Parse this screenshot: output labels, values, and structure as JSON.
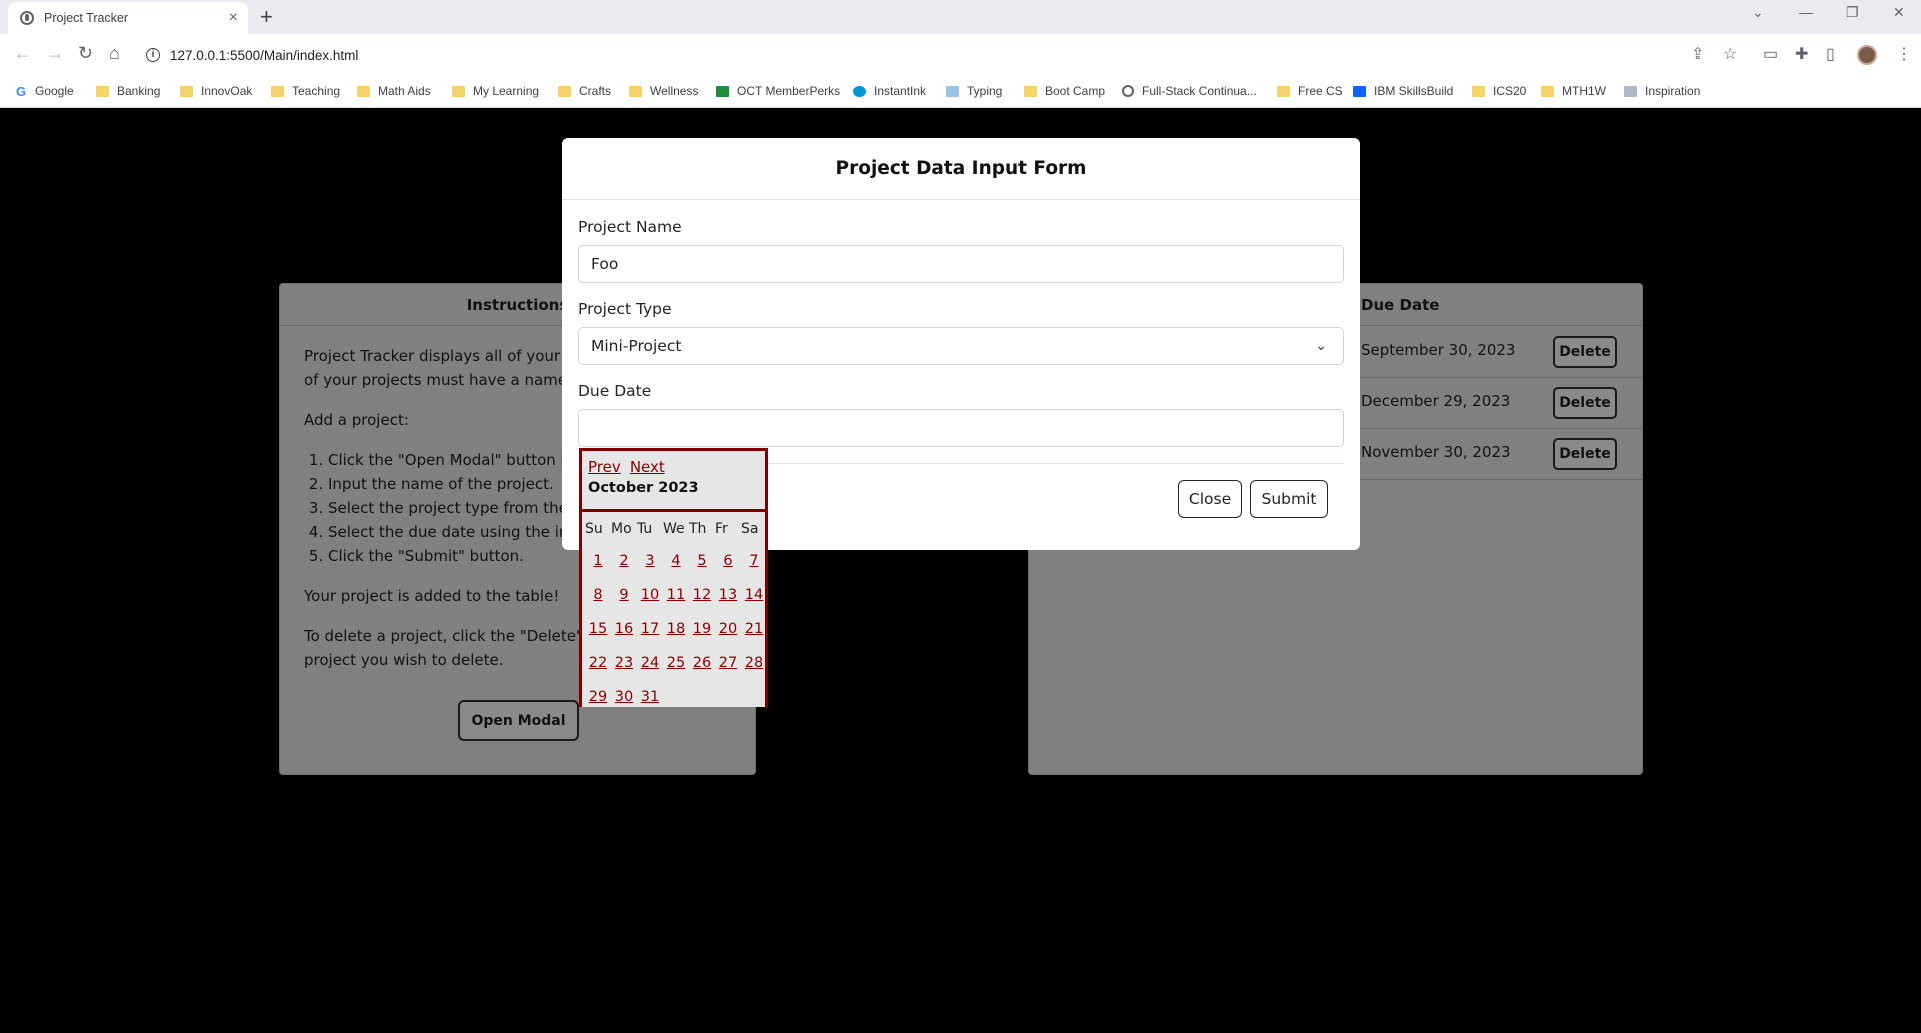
{
  "browser": {
    "tab_title": "Project Tracker",
    "tab_close": "×",
    "new_tab": "+",
    "url": "127.0.0.1:5500/Main/index.html",
    "bookmarks": [
      {
        "label": "Google",
        "icon": "google-icon"
      },
      {
        "label": "Banking",
        "icon": "folder-icon"
      },
      {
        "label": "InnovOak",
        "icon": "folder-icon"
      },
      {
        "label": "Teaching",
        "icon": "folder-icon"
      },
      {
        "label": "Math Aids",
        "icon": "folder-icon"
      },
      {
        "label": "My Learning",
        "icon": "folder-icon"
      },
      {
        "label": "Crafts",
        "icon": "folder-icon"
      },
      {
        "label": "Wellness",
        "icon": "folder-icon"
      },
      {
        "label": "OCT MemberPerks",
        "icon": "oct-icon"
      },
      {
        "label": "InstantInk",
        "icon": "hp-icon"
      },
      {
        "label": "Typing",
        "icon": "typing-icon"
      },
      {
        "label": "Boot Camp",
        "icon": "folder-icon"
      },
      {
        "label": "Full-Stack Continua...",
        "icon": "globe-icon"
      },
      {
        "label": "Free CS",
        "icon": "folder-icon"
      },
      {
        "label": "IBM SkillsBuild",
        "icon": "ibm-icon"
      },
      {
        "label": "ICS20",
        "icon": "folder-icon"
      },
      {
        "label": "MTH1W",
        "icon": "folder-icon"
      },
      {
        "label": "Inspiration",
        "icon": "nf-icon"
      }
    ]
  },
  "instructions": {
    "header": "Instructions",
    "intro_1": "Project Tracker displays all of your p",
    "intro_2": "of your projects must have a name,",
    "add_heading": "Add a project:",
    "steps": [
      "Click the \"Open Modal\" button b",
      "Input the name of the project.",
      "Select the project type from the",
      "Select the due date using the int",
      "Click the \"Submit\" button."
    ],
    "added": "Your project is added to the table!",
    "delete_1": "To delete a project, click the \"Delete\"",
    "delete_2": "project you wish to delete.",
    "open_modal": "Open Modal"
  },
  "table": {
    "due_header": "Due Date",
    "rows": [
      {
        "due": "September 30, 2023",
        "action": "Delete"
      },
      {
        "due": "December 29, 2023",
        "action": "Delete"
      },
      {
        "due": "November 30, 2023",
        "action": "Delete"
      }
    ]
  },
  "modal": {
    "title": "Project Data Input Form",
    "name_label": "Project Name",
    "name_value": "Foo",
    "type_label": "Project Type",
    "type_value": "Mini-Project",
    "date_label": "Due Date",
    "date_value": "",
    "close": "Close",
    "submit": "Submit"
  },
  "datepicker": {
    "prev": "Prev",
    "next": "Next",
    "month": "October 2023",
    "weekdays": [
      "Su",
      "Mo",
      "Tu",
      "We",
      "Th",
      "Fr",
      "Sa"
    ],
    "days": [
      "1",
      "2",
      "3",
      "4",
      "5",
      "6",
      "7",
      "8",
      "9",
      "10",
      "11",
      "12",
      "13",
      "14",
      "15",
      "16",
      "17",
      "18",
      "19",
      "20",
      "21",
      "22",
      "23",
      "24",
      "25",
      "26",
      "27",
      "28",
      "29",
      "30",
      "31"
    ]
  }
}
